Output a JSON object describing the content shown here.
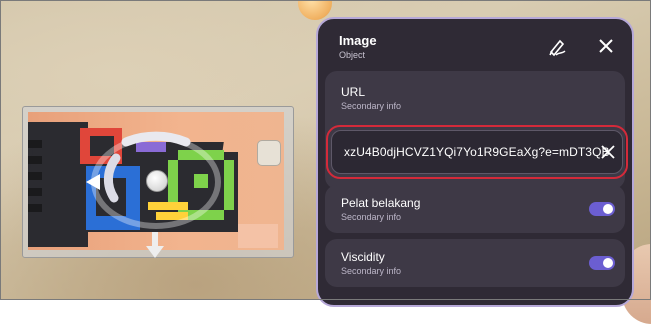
{
  "panel": {
    "title": "Image",
    "subtitle": "Object",
    "icons": {
      "edit": "pen-icon",
      "close": "close-icon"
    },
    "url_row": {
      "label": "URL",
      "secondary": "Secondary info",
      "input_value": "xzU4B0djHCVZ1YQi7Yo1R9GEaXg?e=mDT3QB",
      "clear_icon": "close-icon"
    },
    "settings": [
      {
        "label": "Pelat belakang",
        "secondary": "Secondary info",
        "toggle_on": true
      },
      {
        "label": "Viscidity",
        "secondary": "Secondary info",
        "toggle_on": true
      }
    ]
  },
  "colors": {
    "panel_bg": "#2f2a35",
    "panel_border": "#b6a8d8",
    "row_bg": "#3e3946",
    "highlight": "#d42a3a",
    "toggle_on": "#6b5ed1"
  }
}
